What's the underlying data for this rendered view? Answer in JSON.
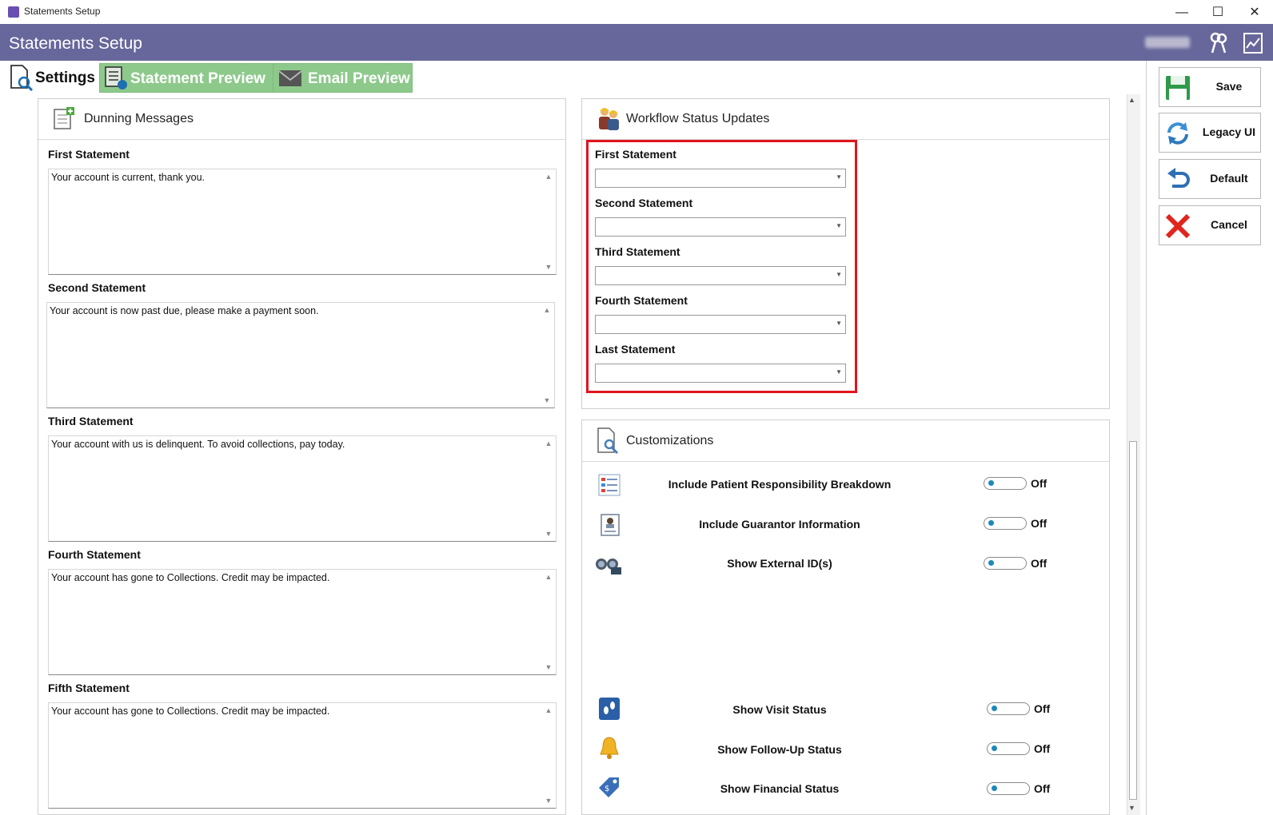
{
  "window": {
    "title": "Statements Setup",
    "controls": {
      "minimize": "—",
      "maximize": "☐",
      "close": "✕"
    }
  },
  "header": {
    "title": "Statements Setup"
  },
  "tabs": [
    {
      "label": "Settings",
      "active": true
    },
    {
      "label": "Statement Preview",
      "active": false
    },
    {
      "label": "Email Preview",
      "active": false
    }
  ],
  "dunning": {
    "title": "Dunning Messages",
    "messages": [
      {
        "label": "First Statement",
        "text": "Your account is current, thank you."
      },
      {
        "label": "Second Statement",
        "text": "Your account is now past due, please make a payment soon."
      },
      {
        "label": "Third Statement",
        "text": "Your account with us is delinquent. To avoid collections, pay today."
      },
      {
        "label": "Fourth Statement",
        "text": "Your account has gone to Collections. Credit may be impacted."
      },
      {
        "label": "Fifth Statement",
        "text": "Your account has gone to Collections. Credit may be impacted."
      }
    ]
  },
  "workflow": {
    "title": "Workflow Status Updates",
    "items": [
      {
        "label": "First Statement",
        "value": ""
      },
      {
        "label": "Second Statement",
        "value": ""
      },
      {
        "label": "Third Statement",
        "value": ""
      },
      {
        "label": "Fourth Statement",
        "value": ""
      },
      {
        "label": "Last Statement",
        "value": ""
      }
    ]
  },
  "customizations": {
    "title": "Customizations",
    "options": [
      {
        "label": "Include Patient Responsibility Breakdown",
        "state": "Off",
        "icon": "list-icon"
      },
      {
        "label": "Include Guarantor Information",
        "state": "Off",
        "icon": "id-card-icon"
      },
      {
        "label": "Show External ID(s)",
        "state": "Off",
        "icon": "binoculars-icon"
      },
      {
        "label": "Show Visit Status",
        "state": "Off",
        "icon": "footprints-icon"
      },
      {
        "label": "Show Follow-Up Status",
        "state": "Off",
        "icon": "bell-icon"
      },
      {
        "label": "Show Financial Status",
        "state": "Off",
        "icon": "price-tag-icon"
      }
    ]
  },
  "sidebar": {
    "buttons": [
      {
        "label": "Save",
        "icon": "floppy-disk-icon"
      },
      {
        "label": "Legacy UI",
        "icon": "refresh-icon"
      },
      {
        "label": "Default",
        "icon": "undo-icon"
      },
      {
        "label": "Cancel",
        "icon": "close-icon"
      }
    ]
  },
  "colors": {
    "header_bg": "#68679b",
    "tab_green": "#8ec98c",
    "highlight_red": "#e0141e",
    "toggle_dot": "#1e88b8"
  }
}
